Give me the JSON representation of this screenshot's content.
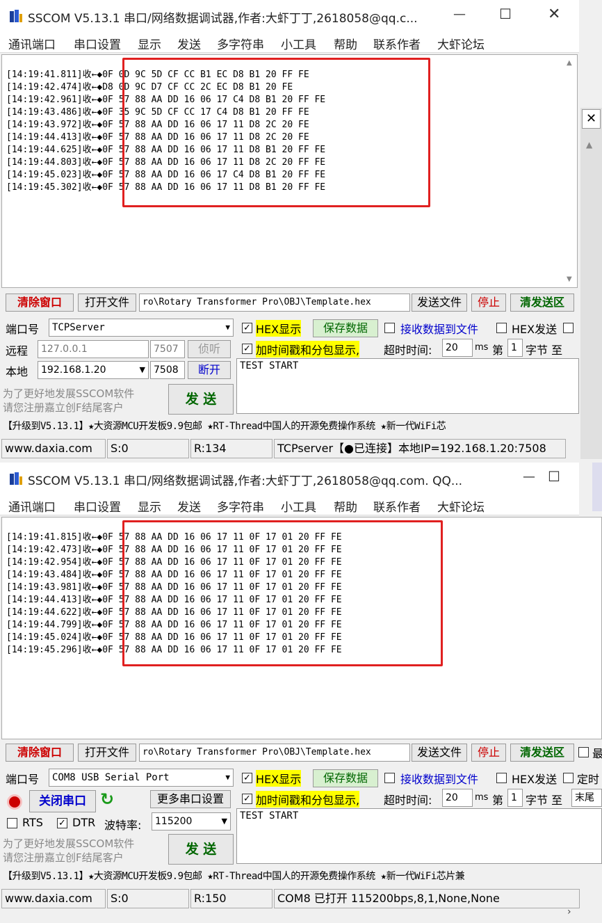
{
  "window1": {
    "title": "SSCOM V5.13.1 串口/网络数据调试器,作者:大虾丁丁,2618058@qq.c...",
    "menu": [
      "通讯端口",
      "串口设置",
      "显示",
      "发送",
      "多字符串",
      "小工具",
      "帮助",
      "联系作者",
      "大虾论坛"
    ],
    "log": [
      "[14:19:41.811]收←◆0F 0D 9C 5D CF CC B1 EC D8 B1 20 FF FE",
      "[14:19:42.474]收←◆D8 0D 9C D7 CF CC 2C EC D8 B1 20 FE",
      "[14:19:42.961]收←◆0F 57 88 AA DD 16 06 17 C4 D8 B1 20 FF FE",
      "[14:19:43.486]收←◆0F 35 9C 5D CF CC 17 C4 D8 B1 20 FF FE",
      "[14:19:43.972]收←◆0F 57 88 AA DD 16 06 17 11 D8 2C 20 FE",
      "[14:19:44.413]收←◆0F 57 88 AA DD 16 06 17 11 D8 2C 20 FE",
      "[14:19:44.625]收←◆0F 57 88 AA DD 16 06 17 11 D8 B1 20 FF FE",
      "[14:19:44.803]收←◆0F 57 88 AA DD 16 06 17 11 D8 2C 20 FF FE",
      "[14:19:45.023]收←◆0F 57 88 AA DD 16 06 17 C4 D8 B1 20 FF FE",
      "[14:19:45.302]收←◆0F 57 88 AA DD 16 06 17 11 D8 B1 20 FF FE"
    ],
    "toolbar": {
      "clear": "清除窗口",
      "open_file": "打开文件",
      "file_path": "ro\\Rotary Transformer Pro\\OBJ\\Template.hex",
      "send_file": "发送文件",
      "stop": "停止",
      "clear_send": "清发送区"
    },
    "port_label": "端口号",
    "port_value": "TCPServer",
    "remote_label": "远程",
    "remote_ip": "127.0.0.1",
    "remote_port": "7507",
    "listen": "侦听",
    "local_label": "本地",
    "local_ip": "192.168.1.20",
    "local_port": "7508",
    "disconnect": "断开",
    "hex_show": "HEX显示",
    "save_data": "保存数据",
    "recv_to_file": "接收数据到文件",
    "hex_send": "HEX发送",
    "timestamp": "加时间戳和分包显示,",
    "timeout_label": "超时时间:",
    "timeout_value": "20",
    "ms": "ms",
    "nth": "第",
    "nth_value": "1",
    "byte_to": "字节 至",
    "send_text": "TEST START",
    "register_msg1": "为了更好地发展SSCOM软件",
    "register_msg2": "请您注册嘉立创F结尾客户",
    "send_btn": "发  送",
    "promo": "【升级到V5.13.1】★大资源MCU开发板9.9包邮 ★RT-Thread中国人的开源免费操作系统 ★新一代WiFi芯",
    "status": {
      "site": "www.daxia.com",
      "sent": "S:0",
      "recv": "R:134",
      "conn": "TCPserver【●已连接】本地IP=192.168.1.20:7508"
    }
  },
  "window2": {
    "title": "SSCOM V5.13.1 串口/网络数据调试器,作者:大虾丁丁,2618058@qq.com. QQ...",
    "menu": [
      "通讯端口",
      "串口设置",
      "显示",
      "发送",
      "多字符串",
      "小工具",
      "帮助",
      "联系作者",
      "大虾论坛"
    ],
    "log": [
      "[14:19:41.815]收←◆0F 57 88 AA DD 16 06 17 11 0F 17 01 20 FF FE",
      "[14:19:42.473]收←◆0F 57 88 AA DD 16 06 17 11 0F 17 01 20 FF FE",
      "[14:19:42.954]收←◆0F 57 88 AA DD 16 06 17 11 0F 17 01 20 FF FE",
      "[14:19:43.484]收←◆0F 57 88 AA DD 16 06 17 11 0F 17 01 20 FF FE",
      "[14:19:43.981]收←◆0F 57 88 AA DD 16 06 17 11 0F 17 01 20 FF FE",
      "[14:19:44.413]收←◆0F 57 88 AA DD 16 06 17 11 0F 17 01 20 FF FE",
      "[14:19:44.622]收←◆0F 57 88 AA DD 16 06 17 11 0F 17 01 20 FF FE",
      "[14:19:44.799]收←◆0F 57 88 AA DD 16 06 17 11 0F 17 01 20 FF FE",
      "[14:19:45.024]收←◆0F 57 88 AA DD 16 06 17 11 0F 17 01 20 FF FE",
      "[14:19:45.296]收←◆0F 57 88 AA DD 16 06 17 11 0F 17 01 20 FF FE"
    ],
    "toolbar": {
      "clear": "清除窗口",
      "open_file": "打开文件",
      "file_path": "ro\\Rotary Transformer Pro\\OBJ\\Template.hex",
      "send_file": "发送文件",
      "stop": "停止",
      "clear_send": "清发送区",
      "last": "最"
    },
    "port_label": "端口号",
    "port_value": "COM8 USB Serial Port",
    "close_port": "关闭串口",
    "more_settings": "更多串口设置",
    "rts": "RTS",
    "dtr": "DTR",
    "baud_label": "波特率:",
    "baud_value": "115200",
    "hex_show": "HEX显示",
    "save_data": "保存数据",
    "recv_to_file": "接收数据到文件",
    "hex_send": "HEX发送",
    "timed": "定时",
    "timestamp": "加时间戳和分包显示,",
    "timeout_label": "超时时间:",
    "timeout_value": "20",
    "ms": "ms",
    "nth": "第",
    "nth_value": "1",
    "byte_to": "字节 至",
    "tail": "末尾",
    "send_text": "TEST START",
    "register_msg1": "为了更好地发展SSCOM软件",
    "register_msg2": "请您注册嘉立创F结尾客户",
    "send_btn": "发  送",
    "promo": "【升级到V5.13.1】★大资源MCU开发板9.9包邮 ★RT-Thread中国人的开源免费操作系统 ★新一代WiFi芯片兼",
    "status": {
      "site": "www.daxia.com",
      "sent": "S:0",
      "recv": "R:150",
      "conn": "COM8 已打开  115200bps,8,1,None,None"
    }
  },
  "colors": {
    "highlight_box": "#e02020",
    "hex_label_bg": "#ffff00",
    "accent_red": "#cc0000",
    "accent_blue": "#0000cc"
  }
}
